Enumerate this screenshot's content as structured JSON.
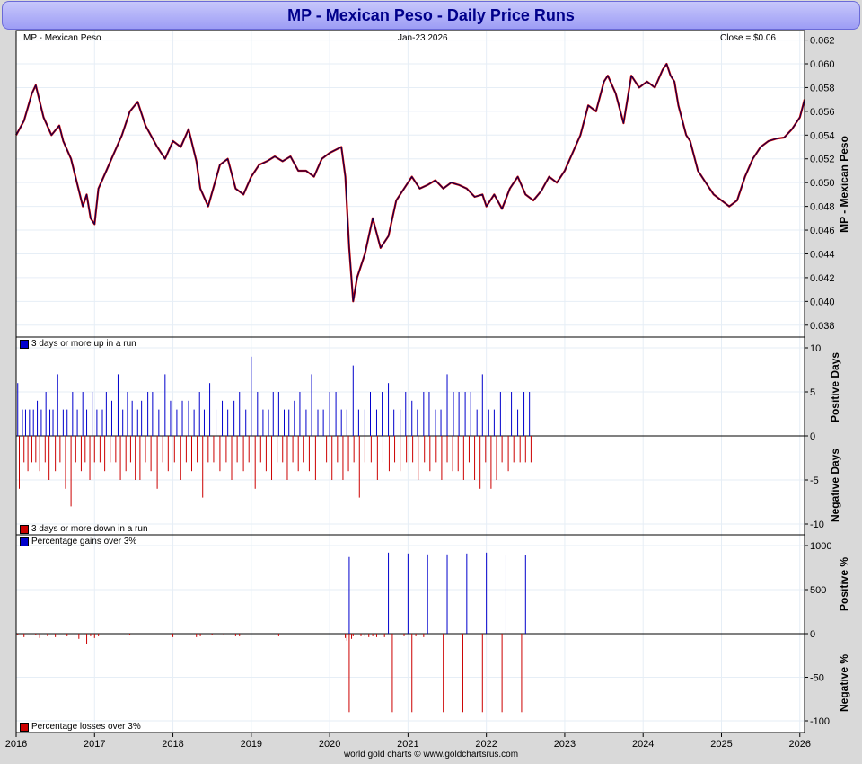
{
  "title": "MP  -  Mexican Peso - Daily Price Runs",
  "footer": "world gold charts © www.goldchartsrus.com",
  "header": {
    "left": "MP  -  Mexican Peso",
    "center": "Jan-23  2026",
    "right": "Close = $0.06"
  },
  "colors": {
    "up": "#0000cc",
    "down": "#cc0000",
    "price": "#000033",
    "grid": "#e6eef6",
    "title_text": "#00008b"
  },
  "chart_data": [
    {
      "type": "line",
      "panel": "price",
      "ylabel": "MP  -  Mexican Peso",
      "ylim": [
        0.037,
        0.0628
      ],
      "yticks": [
        "0.062",
        "0.060",
        "0.058",
        "0.056",
        "0.054",
        "0.052",
        "0.050",
        "0.048",
        "0.046",
        "0.044",
        "0.042",
        "0.040",
        "0.038"
      ],
      "xticks": [
        "2016",
        "2017",
        "2018",
        "2019",
        "2020",
        "2021",
        "2022",
        "2023",
        "2024",
        "2025",
        "2026"
      ],
      "series": [
        {
          "x": [
            2016.0,
            2016.1,
            2016.2,
            2016.25,
            2016.35,
            2016.45,
            2016.55,
            2016.6,
            2016.7,
            2016.85,
            2016.9,
            2016.95,
            2017.0,
            2017.05,
            2017.15,
            2017.25,
            2017.35,
            2017.45,
            2017.55,
            2017.65,
            2017.8,
            2017.9,
            2018.0,
            2018.1,
            2018.2,
            2018.3,
            2018.35,
            2018.45,
            2018.6,
            2018.7,
            2018.8,
            2018.9,
            2019.0,
            2019.1,
            2019.2,
            2019.3,
            2019.4,
            2019.5,
            2019.6,
            2019.7,
            2019.8,
            2019.9,
            2020.0,
            2020.15,
            2020.2,
            2020.25,
            2020.3,
            2020.35,
            2020.45,
            2020.55,
            2020.65,
            2020.75,
            2020.85,
            2020.95,
            2021.05,
            2021.15,
            2021.25,
            2021.35,
            2021.45,
            2021.55,
            2021.65,
            2021.75,
            2021.85,
            2021.95,
            2022.0,
            2022.1,
            2022.2,
            2022.3,
            2022.4,
            2022.5,
            2022.6,
            2022.7,
            2022.8,
            2022.9,
            2023.0,
            2023.1,
            2023.2,
            2023.3,
            2023.4,
            2023.5,
            2023.55,
            2023.65,
            2023.75,
            2023.85,
            2023.95,
            2024.05,
            2024.15,
            2024.25,
            2024.3,
            2024.35,
            2024.4,
            2024.45,
            2024.55,
            2024.6,
            2024.7,
            2024.8,
            2024.9,
            2025.0,
            2025.1,
            2025.2,
            2025.3,
            2025.4,
            2025.5,
            2025.6,
            2025.7,
            2025.8,
            2025.9,
            2026.0,
            2026.06
          ],
          "y": [
            0.054,
            0.0552,
            0.0575,
            0.0582,
            0.0555,
            0.054,
            0.0548,
            0.0535,
            0.052,
            0.048,
            0.049,
            0.047,
            0.0465,
            0.0495,
            0.051,
            0.0525,
            0.054,
            0.056,
            0.0568,
            0.0548,
            0.053,
            0.052,
            0.0535,
            0.053,
            0.0545,
            0.0518,
            0.0495,
            0.048,
            0.0515,
            0.052,
            0.0495,
            0.049,
            0.0505,
            0.0515,
            0.0518,
            0.0522,
            0.0518,
            0.0522,
            0.051,
            0.051,
            0.0505,
            0.052,
            0.0525,
            0.053,
            0.0505,
            0.0445,
            0.04,
            0.042,
            0.044,
            0.047,
            0.0445,
            0.0455,
            0.0485,
            0.0495,
            0.0505,
            0.0495,
            0.0498,
            0.0502,
            0.0495,
            0.05,
            0.0498,
            0.0495,
            0.0488,
            0.049,
            0.048,
            0.049,
            0.0478,
            0.0495,
            0.0505,
            0.049,
            0.0485,
            0.0493,
            0.0505,
            0.05,
            0.051,
            0.0525,
            0.054,
            0.0565,
            0.056,
            0.0585,
            0.059,
            0.0575,
            0.055,
            0.059,
            0.058,
            0.0585,
            0.058,
            0.0595,
            0.06,
            0.059,
            0.0585,
            0.0565,
            0.054,
            0.0535,
            0.051,
            0.05,
            0.049,
            0.0485,
            0.048,
            0.0485,
            0.0505,
            0.052,
            0.053,
            0.0535,
            0.0537,
            0.0538,
            0.0545,
            0.0555,
            0.057
          ]
        }
      ]
    },
    {
      "type": "bar",
      "panel": "runs",
      "ylabel_top": "Positive Days",
      "ylabel_bottom": "Negative Days",
      "ylim": [
        -11,
        11
      ],
      "yticks": [
        "10",
        "5",
        "0",
        "-5",
        "-10"
      ],
      "legend": [
        "3 days or more up in a run",
        "3 days or more down in a run"
      ],
      "series": [
        {
          "name": "3 days or more up in a run",
          "x": [
            2016.02,
            2016.08,
            2016.12,
            2016.17,
            2016.22,
            2016.27,
            2016.32,
            2016.38,
            2016.43,
            2016.47,
            2016.53,
            2016.6,
            2016.65,
            2016.72,
            2016.78,
            2016.85,
            2016.9,
            2016.97,
            2017.03,
            2017.1,
            2017.15,
            2017.22,
            2017.3,
            2017.36,
            2017.42,
            2017.48,
            2017.55,
            2017.6,
            2017.68,
            2017.74,
            2017.82,
            2017.9,
            2017.97,
            2018.05,
            2018.12,
            2018.2,
            2018.27,
            2018.34,
            2018.4,
            2018.47,
            2018.55,
            2018.63,
            2018.7,
            2018.78,
            2018.85,
            2018.93,
            2019.0,
            2019.08,
            2019.15,
            2019.22,
            2019.28,
            2019.35,
            2019.42,
            2019.48,
            2019.55,
            2019.62,
            2019.7,
            2019.77,
            2019.85,
            2019.92,
            2020.0,
            2020.08,
            2020.15,
            2020.22,
            2020.3,
            2020.37,
            2020.45,
            2020.52,
            2020.6,
            2020.67,
            2020.75,
            2020.82,
            2020.9,
            2020.97,
            2021.05,
            2021.12,
            2021.2,
            2021.27,
            2021.35,
            2021.42,
            2021.5,
            2021.58,
            2021.65,
            2021.73,
            2021.8,
            2021.88,
            2021.95,
            2022.03,
            2022.1,
            2022.18,
            2022.25,
            2022.32,
            2022.4,
            2022.48,
            2022.55
          ],
          "values": [
            6,
            3,
            3,
            3,
            3,
            4,
            3,
            5,
            3,
            3,
            7,
            3,
            3,
            5,
            3,
            5,
            3,
            5,
            3,
            3,
            5,
            4,
            7,
            3,
            5,
            4,
            3,
            4,
            5,
            5,
            3,
            7,
            4,
            3,
            4,
            4,
            3,
            5,
            3,
            6,
            3,
            4,
            3,
            4,
            5,
            3,
            9,
            5,
            3,
            3,
            5,
            5,
            3,
            3,
            4,
            5,
            3,
            7,
            3,
            3,
            5,
            5,
            3,
            3,
            8,
            3,
            3,
            5,
            3,
            5,
            6,
            3,
            3,
            5,
            4,
            3,
            5,
            5,
            3,
            3,
            7,
            5,
            5,
            5,
            5,
            3,
            7,
            3,
            3,
            5,
            4,
            5,
            3,
            5,
            5
          ]
        },
        {
          "name": "3 days or more down in a run",
          "x": [
            2016.04,
            2016.1,
            2016.15,
            2016.2,
            2016.25,
            2016.3,
            2016.37,
            2016.42,
            2016.5,
            2016.56,
            2016.63,
            2016.7,
            2016.76,
            2016.83,
            2016.88,
            2016.94,
            2017.0,
            2017.07,
            2017.13,
            2017.2,
            2017.27,
            2017.33,
            2017.4,
            2017.46,
            2017.52,
            2017.58,
            2017.65,
            2017.72,
            2017.8,
            2017.87,
            2017.94,
            2018.02,
            2018.1,
            2018.17,
            2018.24,
            2018.31,
            2018.38,
            2018.45,
            2018.52,
            2018.6,
            2018.68,
            2018.75,
            2018.82,
            2018.9,
            2018.97,
            2019.05,
            2019.12,
            2019.19,
            2019.26,
            2019.33,
            2019.4,
            2019.46,
            2019.53,
            2019.6,
            2019.67,
            2019.74,
            2019.82,
            2019.89,
            2019.96,
            2020.03,
            2020.1,
            2020.17,
            2020.24,
            2020.31,
            2020.38,
            2020.45,
            2020.53,
            2020.61,
            2020.68,
            2020.76,
            2020.83,
            2020.9,
            2020.98,
            2021.06,
            2021.13,
            2021.21,
            2021.28,
            2021.36,
            2021.43,
            2021.5,
            2021.57,
            2021.64,
            2021.71,
            2021.78,
            2021.85,
            2021.92,
            2021.99,
            2022.06,
            2022.13,
            2022.2,
            2022.28,
            2022.35,
            2022.43,
            2022.5,
            2022.57
          ],
          "values": [
            -6,
            -3,
            -4,
            -3,
            -3,
            -4,
            -3,
            -5,
            -4,
            -3,
            -6,
            -8,
            -3,
            -4,
            -3,
            -5,
            -3,
            -3,
            -4,
            -3,
            -3,
            -5,
            -4,
            -3,
            -5,
            -5,
            -3,
            -4,
            -6,
            -3,
            -4,
            -3,
            -5,
            -3,
            -4,
            -3,
            -7,
            -3,
            -3,
            -4,
            -3,
            -5,
            -3,
            -4,
            -3,
            -6,
            -3,
            -4,
            -5,
            -3,
            -3,
            -5,
            -3,
            -4,
            -3,
            -4,
            -5,
            -3,
            -3,
            -5,
            -3,
            -5,
            -4,
            -3,
            -7,
            -3,
            -3,
            -5,
            -3,
            -4,
            -3,
            -4,
            -3,
            -3,
            -5,
            -3,
            -4,
            -3,
            -5,
            -3,
            -4,
            -4,
            -5,
            -3,
            -5,
            -6,
            -3,
            -6,
            -5,
            -3,
            -4,
            -3,
            -3,
            -3,
            -3
          ]
        }
      ]
    },
    {
      "type": "bar",
      "panel": "percentage",
      "ylabel_top": "Positive %",
      "ylabel_bottom": "Negative %",
      "ylim_positive": [
        0,
        1000
      ],
      "ylim_negative": [
        -100,
        0
      ],
      "yticks": [
        "1000",
        "500",
        "0",
        "-50",
        "-100"
      ],
      "legend": [
        "Percentage gains over 3%",
        "Percentage losses over 3%"
      ],
      "series": [
        {
          "name": "Percentage gains over 3%",
          "x": [
            2020.25,
            2020.5,
            2020.75,
            2021.0,
            2021.25,
            2021.5,
            2021.75,
            2022.0,
            2022.25,
            2022.5
          ],
          "values": [
            870,
            0,
            920,
            910,
            900,
            900,
            910,
            920,
            900,
            890
          ]
        },
        {
          "name": "Percentage losses over 3%",
          "x": [
            2016.02,
            2016.1,
            2016.25,
            2016.3,
            2016.4,
            2016.5,
            2016.65,
            2016.8,
            2016.9,
            2016.95,
            2017.0,
            2017.05,
            2017.45,
            2018.0,
            2018.3,
            2018.35,
            2018.5,
            2018.65,
            2018.8,
            2018.85,
            2019.35,
            2020.2,
            2020.22,
            2020.25,
            2020.28,
            2020.3,
            2020.4,
            2020.45,
            2020.5,
            2020.55,
            2020.6,
            2020.7,
            2020.8,
            2020.95,
            2021.05,
            2021.1,
            2021.2,
            2021.45,
            2021.7,
            2021.95,
            2022.2,
            2022.45
          ],
          "values": [
            -2,
            -4,
            -2,
            -5,
            -3,
            -4,
            -3,
            -6,
            -12,
            -3,
            -5,
            -3,
            -2,
            -4,
            -4,
            -3,
            -2,
            -2,
            -3,
            -3,
            -3,
            -5,
            -8,
            -90,
            -6,
            -3,
            -3,
            -3,
            -4,
            -3,
            -4,
            -4,
            -90,
            -3,
            -90,
            -3,
            -4,
            -90,
            -90,
            -90,
            -90,
            -90
          ]
        }
      ]
    }
  ]
}
